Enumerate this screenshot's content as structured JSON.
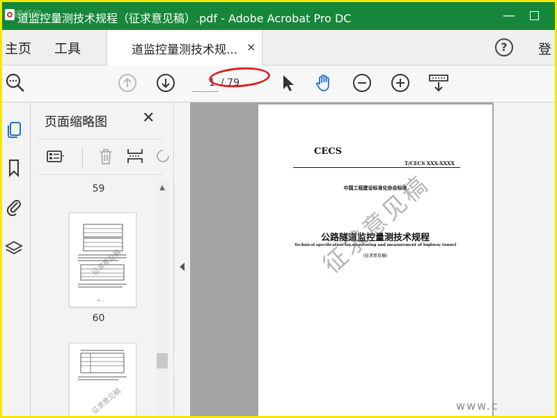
{
  "window": {
    "title": "道监控量测技术规程（征求意见稿）.pdf - Adobe Acrobat Pro DC",
    "logo_watermark": "道纸网",
    "min_glyph": "—",
    "colors": {
      "titlebar": "#16873a",
      "accent_red": "#dc2020"
    }
  },
  "tabbar": {
    "home": "主页",
    "tools": "工具",
    "doc_tab": "道监控量测技术规...",
    "close_glyph": "×",
    "help_glyph": "?",
    "login": "登"
  },
  "toolbar": {
    "page_current": "1",
    "page_total": "/ 79",
    "icons": [
      "find-icon",
      "page-up-icon",
      "page-down-icon",
      "select-arrow-icon",
      "hand-icon",
      "zoom-out-icon",
      "zoom-in-icon",
      "scroll-mode-icon"
    ]
  },
  "left_rail": {
    "icons": [
      "page-thumbnails-icon",
      "bookmark-icon",
      "attachment-icon",
      "layers-icon"
    ]
  },
  "thumb_panel": {
    "title": "页面缩略图",
    "close_glyph": "✕",
    "pages": [
      {
        "label": "59"
      },
      {
        "label": "60",
        "mark": "-",
        "watermark": "征求意见稿"
      },
      {
        "label": "",
        "watermark": "征求意见稿"
      }
    ]
  },
  "document": {
    "org": "CECS",
    "std_number": "T/CECS XXX-XXXX",
    "association": "中国工程建设标准化协会标准",
    "title_cn": "公路隧道监控量测技术规程",
    "title_en": "Technical specification for monitoring and measurement of highway tunnel",
    "subtitle": "(征求意见稿)",
    "watermark": "征求意见稿",
    "url_watermark": "www.c"
  }
}
